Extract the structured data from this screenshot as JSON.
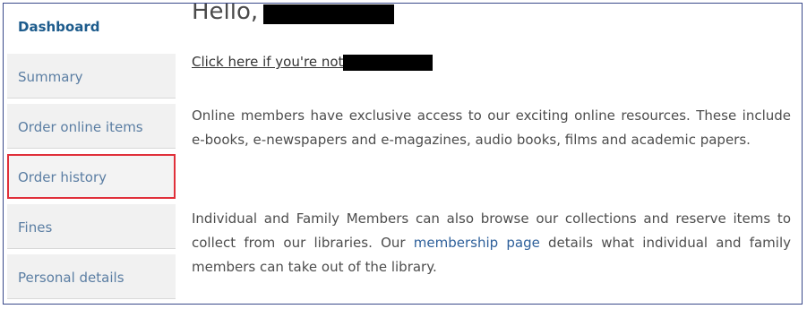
{
  "sidebar": {
    "items": [
      {
        "label": "Dashboard"
      },
      {
        "label": "Summary"
      },
      {
        "label": "Order online items"
      },
      {
        "label": "Order history"
      },
      {
        "label": "Fines"
      },
      {
        "label": "Personal details"
      }
    ]
  },
  "main": {
    "greeting": "Hello,",
    "not_you_link": "Click here if you're not",
    "para1": "Online members have exclusive access to our exciting online resources. These include e-books, e-newspapers and e-magazines, audio books, films and academic papers.",
    "para2_before": "Individual and Family Members can also browse our collections and reserve items to collect from our libraries. Our ",
    "para2_link": "membership page",
    "para2_after": " details what individual and family members can take out of the library."
  },
  "colors": {
    "frame_border": "#3a4a8a",
    "highlight_border": "#e0303a",
    "link": "#2d5f9a",
    "active_item": "#1c5b8c"
  }
}
